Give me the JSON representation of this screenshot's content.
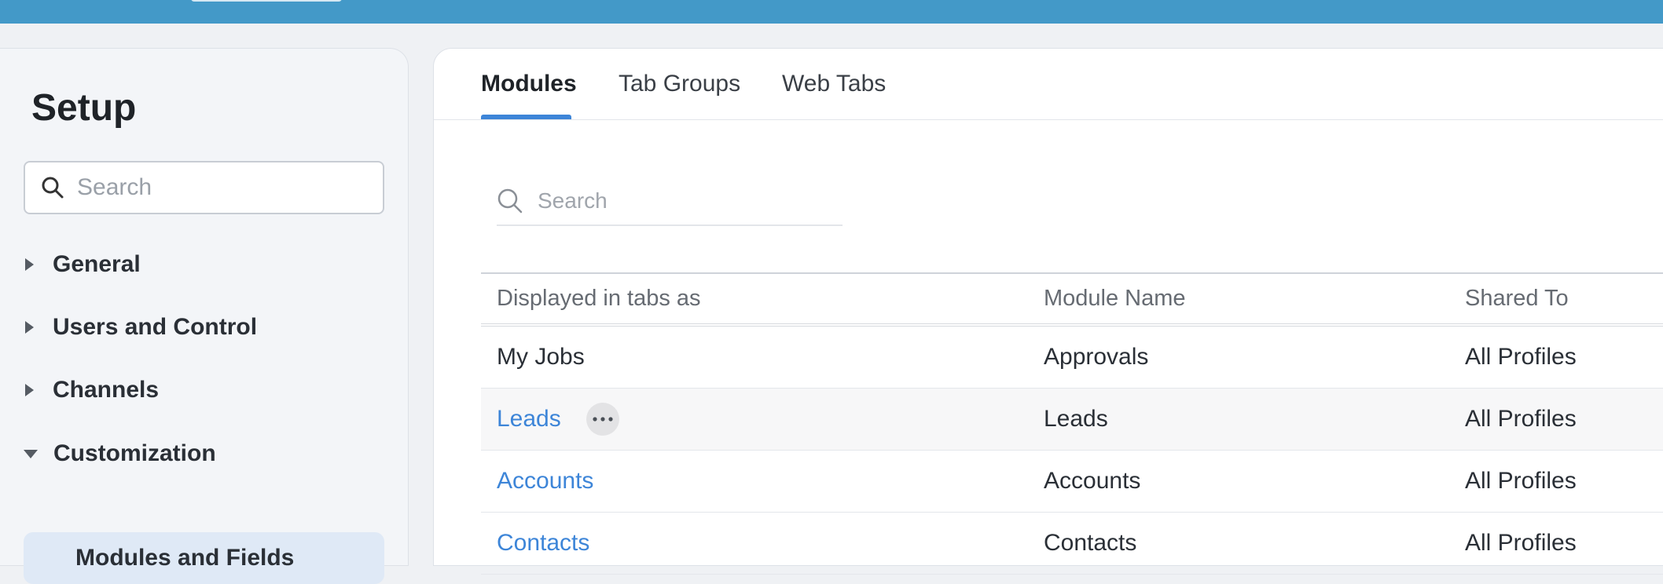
{
  "sidebar": {
    "title": "Setup",
    "search_placeholder": "Search",
    "items": [
      {
        "label": "General"
      },
      {
        "label": "Users and Control"
      },
      {
        "label": "Channels"
      },
      {
        "label": "Customization"
      }
    ],
    "active_sub_item": "Modules and Fields"
  },
  "main": {
    "tabs": [
      {
        "label": "Modules"
      },
      {
        "label": "Tab Groups"
      },
      {
        "label": "Web Tabs"
      }
    ],
    "search_placeholder": "Search",
    "table": {
      "headers": [
        "Displayed in tabs as",
        "Module Name",
        "Shared To"
      ],
      "rows": [
        {
          "tab_name": "My Jobs",
          "module": "Approvals",
          "shared": "All Profiles"
        },
        {
          "tab_name": "Leads",
          "module": "Leads",
          "shared": "All Profiles"
        },
        {
          "tab_name": "Accounts",
          "module": "Accounts",
          "shared": "All Profiles"
        },
        {
          "tab_name": "Contacts",
          "module": "Contacts",
          "shared": "All Profiles"
        }
      ]
    }
  },
  "colors": {
    "topbar": "#4399c8",
    "accent": "#3d85d8",
    "active_sub_item_bg": "#dfe9f6"
  },
  "icons": {
    "search": "search-icon",
    "collapsed": "caret-right-icon",
    "expanded": "caret-down-icon",
    "more": "more-options-icon"
  }
}
